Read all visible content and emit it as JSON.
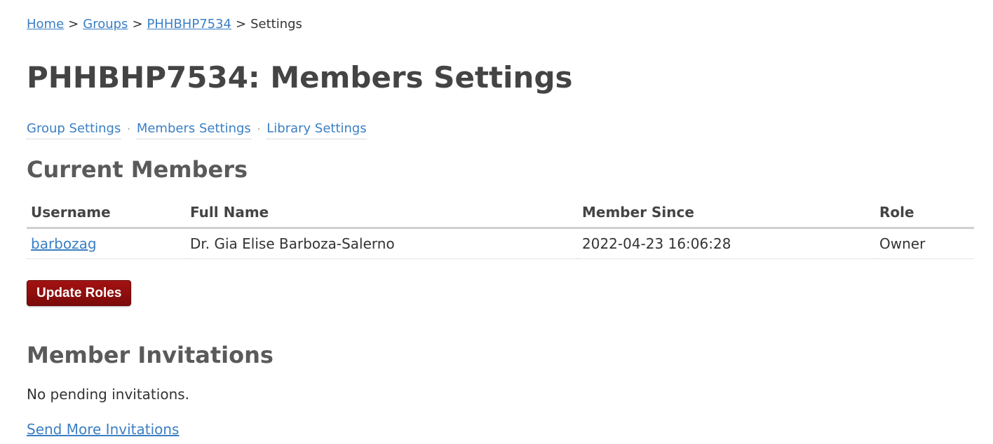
{
  "breadcrumb": {
    "items": [
      {
        "label": "Home",
        "link": true
      },
      {
        "label": "Groups",
        "link": true
      },
      {
        "label": "PHHBHP7534",
        "link": true
      },
      {
        "label": "Settings",
        "link": false
      }
    ],
    "separator": ">"
  },
  "page_title": "PHHBHP7534: Members Settings",
  "subnav": {
    "items": [
      "Group Settings",
      "Members Settings",
      "Library Settings"
    ],
    "separator": "·"
  },
  "current_members": {
    "heading": "Current Members",
    "columns": [
      "Username",
      "Full Name",
      "Member Since",
      "Role"
    ],
    "rows": [
      {
        "username": "barbozag",
        "full_name": "Dr. Gia Elise Barboza-Salerno",
        "member_since": "2022-04-23 16:06:28",
        "role": "Owner"
      }
    ]
  },
  "update_roles_label": "Update Roles",
  "invitations": {
    "heading": "Member Invitations",
    "status": "No pending invitations.",
    "send_more_label": "Send More Invitations"
  },
  "colors": {
    "link": "#3b7fc4",
    "button": "#8b0e0e",
    "heading": "#444444"
  }
}
